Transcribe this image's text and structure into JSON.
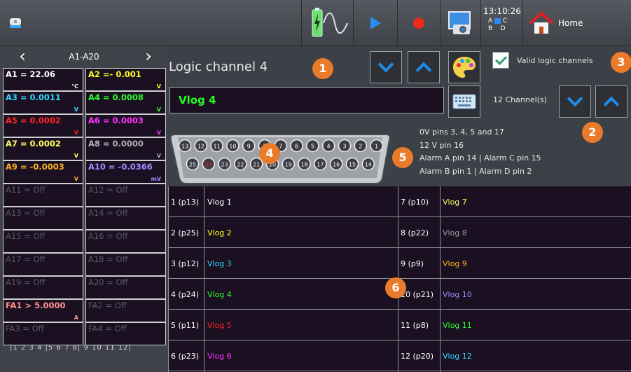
{
  "topbar": {
    "time": "13:10:26",
    "abcd": [
      "A",
      "C",
      "B",
      "D"
    ],
    "home_label": "Home",
    "icons": [
      "usb-drive-icon",
      "battery-icon",
      "waveform-icon",
      "play-icon",
      "record-icon",
      "camera-icon",
      "home-icon"
    ]
  },
  "left": {
    "range_label": "A1-A20",
    "cells": [
      {
        "text": "A1 =  22.06",
        "unit": "°C",
        "color": "#ffffff"
      },
      {
        "text": "A2 =- 0.001",
        "unit": "V",
        "color": "#ffff20"
      },
      {
        "text": "A3 = 0.0011",
        "unit": "V",
        "color": "#30d8ff"
      },
      {
        "text": "A4 = 0.0008",
        "unit": "V",
        "color": "#30ff30"
      },
      {
        "text": "A5 = 0.0002",
        "unit": "V",
        "color": "#ff2424"
      },
      {
        "text": "A6 = 0.0003",
        "unit": "V",
        "color": "#ff30ff"
      },
      {
        "text": "A7 = 0.0002",
        "unit": "V",
        "color": "#ffff60"
      },
      {
        "text": "A8 = 0.0000",
        "unit": "V",
        "color": "#b0b0b8"
      },
      {
        "text": "A9 = -0.0003",
        "unit": "V",
        "color": "#ffb020"
      },
      {
        "text": "A10 = -0.0366",
        "unit": "mV",
        "color": "#9e8cff"
      },
      {
        "text": "A11 = Off",
        "unit": "",
        "color": ""
      },
      {
        "text": "A12 = Off",
        "unit": "",
        "color": ""
      },
      {
        "text": "A13 = Off",
        "unit": "",
        "color": ""
      },
      {
        "text": "A14 = Off",
        "unit": "",
        "color": ""
      },
      {
        "text": "A15 = Off",
        "unit": "",
        "color": ""
      },
      {
        "text": "A16 = Off",
        "unit": "",
        "color": ""
      },
      {
        "text": "A17 = Off",
        "unit": "",
        "color": ""
      },
      {
        "text": "A18 = Off",
        "unit": "",
        "color": ""
      },
      {
        "text": "A19 = Off",
        "unit": "",
        "color": ""
      },
      {
        "text": "A20 = Off",
        "unit": "",
        "color": ""
      },
      {
        "text": "FA1 > 5.0000",
        "unit": "A",
        "color": "#ff9090"
      },
      {
        "text": "FA2 = Off",
        "unit": "",
        "color": ""
      },
      {
        "text": "FA3 = Off",
        "unit": "",
        "color": ""
      },
      {
        "text": "FA4 = Off",
        "unit": "",
        "color": ""
      }
    ],
    "pager": "|1  2  3  4 |5  6  7  8| 9  10  11  12|"
  },
  "main": {
    "title": "Logic channel 4",
    "channel_name": "Vlog  4",
    "valid_label": "Valid logic channels",
    "channels_count": "12 Channel(s)",
    "info_lines": [
      "0V pins 3, 4, 5 and 17",
      "12 V pin  16",
      "Alarm A pin 14 | Alarm C pin 15",
      "Alarm B pin 1 | Alarm D pin 2"
    ],
    "badges": [
      "1",
      "2",
      "3",
      "4",
      "5",
      "6"
    ],
    "connector_top": [
      "13",
      "12",
      "11",
      "10",
      "9",
      "8",
      "7",
      "6",
      "5",
      "4",
      "3",
      "2",
      "1"
    ],
    "connector_bottom": [
      "25",
      "24",
      "23",
      "22",
      "21",
      "20",
      "19",
      "18",
      "17",
      "16",
      "15",
      "14"
    ]
  },
  "table": {
    "left": [
      {
        "pin": "1 (p13)",
        "name": "Vlog  1",
        "color": "#ffffff"
      },
      {
        "pin": "2 (p25)",
        "name": "Vlog  2",
        "color": "#ffff20"
      },
      {
        "pin": "3 (p12)",
        "name": "Vlog  3",
        "color": "#30d8ff"
      },
      {
        "pin": "4 (p24)",
        "name": "Vlog  4",
        "color": "#30ff30"
      },
      {
        "pin": "5 (p11)",
        "name": "Vlog  5",
        "color": "#ff2424"
      },
      {
        "pin": "6 (p23)",
        "name": "Vlog  6",
        "color": "#ff30ff"
      }
    ],
    "right": [
      {
        "pin": "7 (p10)",
        "name": "Vlog  7",
        "color": "#ffff60"
      },
      {
        "pin": "8 (p22)",
        "name": "Vlog  8",
        "color": "#9a9aa2"
      },
      {
        "pin": "9 (p9)",
        "name": "Vlog  9",
        "color": "#ffb020"
      },
      {
        "pin": "10 (p21)",
        "name": "Vlog 10",
        "color": "#9e8cff"
      },
      {
        "pin": "11 (p8)",
        "name": "Vlog 11",
        "color": "#30ff30"
      },
      {
        "pin": "12 (p20)",
        "name": "Vlog 12",
        "color": "#30d8ff"
      }
    ]
  }
}
